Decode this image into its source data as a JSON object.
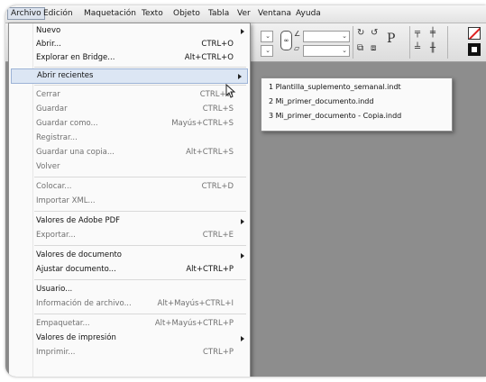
{
  "menubar": {
    "items": [
      "Archivo",
      "Edición",
      "Maquetación",
      "Texto",
      "Objeto",
      "Tabla",
      "Ver",
      "Ventana",
      "Ayuda"
    ]
  },
  "toolbar": {
    "angle_icon": "angle-icon",
    "shear_icon": "shear-icon",
    "chain_icon": "constrain-proportions-icon",
    "rotate_cw_icon": "rotate-cw-icon",
    "rotate_ccw_icon": "rotate-ccw-icon",
    "flip_h_icon": "flip-horizontal-icon",
    "flip_v_icon": "flip-vertical-icon",
    "p_icon": "reference-point-icon",
    "align_icons": [
      "align-top-icon",
      "align-middle-icon",
      "align-bottom-icon",
      "distribute-icon"
    ],
    "stroke_swatch": "stroke-none-swatch",
    "fill_swatch": "fill-swatch"
  },
  "menu": {
    "items": [
      {
        "label": "Nuevo",
        "shortcut": "",
        "submenu": true,
        "state": "enabled"
      },
      {
        "label": "Abrir...",
        "shortcut": "CTRL+O",
        "submenu": false,
        "state": "enabled"
      },
      {
        "label": "Explorar en Bridge...",
        "shortcut": "Alt+CTRL+O",
        "submenu": false,
        "state": "enabled"
      },
      {
        "label": "Abrir recientes",
        "shortcut": "",
        "submenu": true,
        "state": "highlighted"
      },
      {
        "label": "Cerrar",
        "shortcut": "CTRL+W",
        "submenu": false,
        "state": "disabled"
      },
      {
        "label": "Guardar",
        "shortcut": "CTRL+S",
        "submenu": false,
        "state": "disabled"
      },
      {
        "label": "Guardar como...",
        "shortcut": "Mayús+CTRL+S",
        "submenu": false,
        "state": "disabled"
      },
      {
        "label": "Registrar...",
        "shortcut": "",
        "submenu": false,
        "state": "disabled"
      },
      {
        "label": "Guardar una copia...",
        "shortcut": "Alt+CTRL+S",
        "submenu": false,
        "state": "disabled"
      },
      {
        "label": "Volver",
        "shortcut": "",
        "submenu": false,
        "state": "disabled"
      },
      {
        "label": "Colocar...",
        "shortcut": "CTRL+D",
        "submenu": false,
        "state": "disabled"
      },
      {
        "label": "Importar XML...",
        "shortcut": "",
        "submenu": false,
        "state": "disabled"
      },
      {
        "label": "Valores de Adobe PDF",
        "shortcut": "",
        "submenu": true,
        "state": "enabled"
      },
      {
        "label": "Exportar...",
        "shortcut": "CTRL+E",
        "submenu": false,
        "state": "disabled"
      },
      {
        "label": "Valores de documento",
        "shortcut": "",
        "submenu": true,
        "state": "enabled"
      },
      {
        "label": "Ajustar documento...",
        "shortcut": "Alt+CTRL+P",
        "submenu": false,
        "state": "enabled"
      },
      {
        "label": "Usuario...",
        "shortcut": "",
        "submenu": false,
        "state": "enabled"
      },
      {
        "label": "Información de archivo...",
        "shortcut": "Alt+Mayús+CTRL+I",
        "submenu": false,
        "state": "disabled"
      },
      {
        "label": "Empaquetar...",
        "shortcut": "Alt+Mayús+CTRL+P",
        "submenu": false,
        "state": "disabled"
      },
      {
        "label": "Valores de impresión",
        "shortcut": "",
        "submenu": true,
        "state": "enabled"
      },
      {
        "label": "Imprimir...",
        "shortcut": "CTRL+P",
        "submenu": false,
        "state": "disabled"
      }
    ]
  },
  "recent": {
    "items": [
      "1 Plantilla_suplemento_semanal.indt",
      "2 Mi_primer_documento.indd",
      "3 Mi_primer_documento - Copia.indd"
    ]
  },
  "colors": {
    "highlight": "#dce6f4",
    "highlight_border": "#9db3d6",
    "workspace": "#8d8d8d",
    "disabled_text": "#707070"
  }
}
